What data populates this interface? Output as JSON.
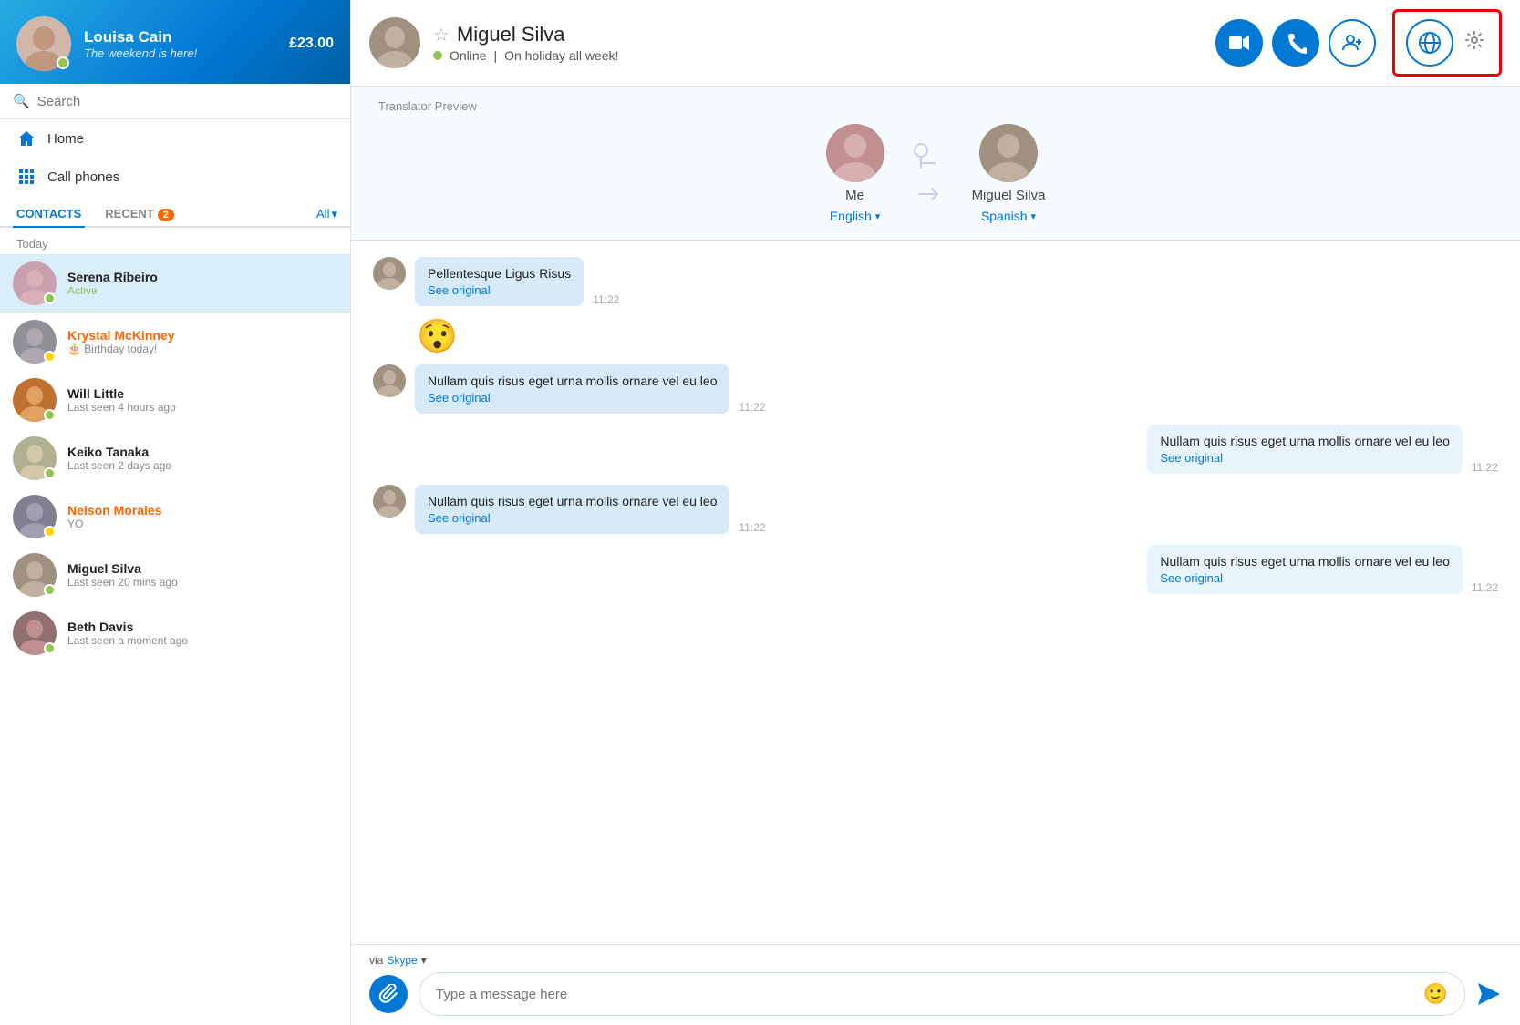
{
  "sidebar": {
    "user": {
      "name": "Louisa Cain",
      "status": "The weekend is here!",
      "balance": "£23.00",
      "online": true
    },
    "search": {
      "placeholder": "Search"
    },
    "nav": [
      {
        "id": "home",
        "label": "Home",
        "icon": "🏠"
      },
      {
        "id": "call-phones",
        "label": "Call phones",
        "icon": "⊞"
      }
    ],
    "tabs": {
      "contacts": "CONTACTS",
      "recent": "RECENT",
      "recent_badge": "2",
      "all": "All"
    },
    "section_label": "Today",
    "contacts": [
      {
        "id": "serena",
        "name": "Serena Ribeiro",
        "status": "Active",
        "status_type": "active",
        "online": "online",
        "av_class": "av-serena",
        "active": true
      },
      {
        "id": "krystal",
        "name": "Krystal McKinney",
        "status": "🎂 Birthday today!",
        "status_type": "normal",
        "online": "away",
        "av_class": "av-krystal",
        "active": false,
        "name_class": "orange"
      },
      {
        "id": "will",
        "name": "Will Little",
        "status": "Last seen 4 hours ago",
        "status_type": "normal",
        "online": "online",
        "av_class": "av-will",
        "active": false
      },
      {
        "id": "keiko",
        "name": "Keiko Tanaka",
        "status": "Last seen 2 days ago",
        "status_type": "normal",
        "online": "online",
        "av_class": "av-keiko",
        "active": false
      },
      {
        "id": "nelson",
        "name": "Nelson Morales",
        "status": "YO",
        "status_type": "normal",
        "online": "away",
        "av_class": "av-nelson",
        "active": false,
        "name_class": "orange"
      },
      {
        "id": "miguel",
        "name": "Miguel Silva",
        "status": "Last seen 20 mins ago",
        "status_type": "normal",
        "online": "online",
        "av_class": "av-miguel",
        "active": false
      },
      {
        "id": "beth",
        "name": "Beth Davis",
        "status": "Last seen a moment ago",
        "status_type": "normal",
        "online": "online",
        "av_class": "av-beth",
        "active": false
      }
    ]
  },
  "chat": {
    "contact": {
      "name": "Miguel Silva",
      "online_status": "Online",
      "status_msg": "On holiday all week!",
      "av_class": "av-miguel"
    },
    "translator_label": "Translator Preview",
    "me": {
      "name": "Me",
      "language": "English",
      "av_class": "av-me"
    },
    "them": {
      "name": "Miguel Silva",
      "language": "Spanish",
      "av_class": "av-miguel"
    },
    "messages": [
      {
        "id": 1,
        "sender": "them",
        "text": "Pellentesque Ligus Risus",
        "see_original": "See original",
        "time": "11:22",
        "align": "left"
      },
      {
        "id": 2,
        "sender": "them",
        "emoji": "😯",
        "align": "left"
      },
      {
        "id": 3,
        "sender": "them",
        "text": "Nullam quis risus eget urna mollis ornare vel eu leo",
        "see_original": "See original",
        "time": "11:22",
        "align": "left"
      },
      {
        "id": 4,
        "sender": "me",
        "text": "Nullam quis risus eget urna mollis ornare vel eu leo",
        "see_original": "See original",
        "time": "11:22",
        "align": "right"
      },
      {
        "id": 5,
        "sender": "them",
        "text": "Nullam quis risus eget urna mollis ornare vel eu leo",
        "see_original": "See original",
        "time": "11:22",
        "align": "left"
      },
      {
        "id": 6,
        "sender": "me",
        "text": "Nullam quis risus eget urna mollis ornare vel eu leo",
        "see_original": "See original",
        "time": "11:22",
        "align": "right"
      }
    ],
    "input": {
      "placeholder": "Type a message here",
      "via_label": "via",
      "skype_label": "Skype",
      "chevron": "▾"
    }
  },
  "icons": {
    "search": "🔍",
    "home": "⌂",
    "call": "📞",
    "video": "📹",
    "add_person": "👤",
    "translator": "🌐",
    "settings": "⚙",
    "attach": "📎",
    "emoji": "🙂",
    "send": "➤",
    "star": "☆",
    "chevron_down": "▾"
  }
}
